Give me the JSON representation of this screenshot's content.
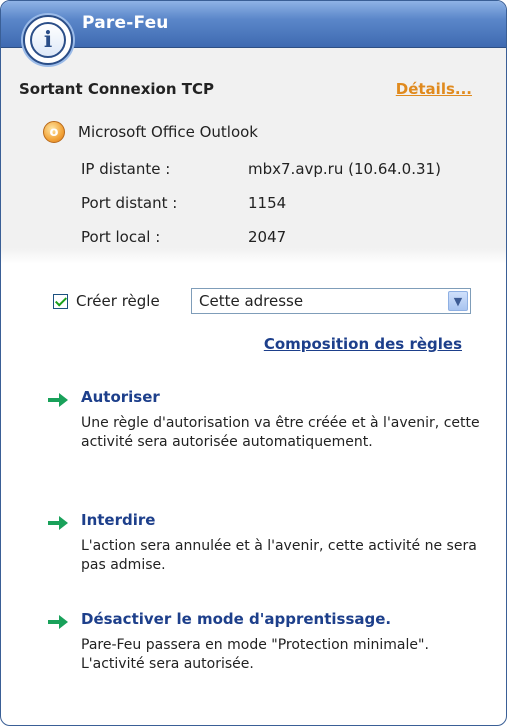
{
  "window": {
    "title": "Pare-Feu",
    "info_icon": "info-icon"
  },
  "alert": {
    "heading": "Sortant Connexion TCP",
    "details_link": "Détails...",
    "app": {
      "icon": "outlook-icon",
      "name": "Microsoft Office Outlook"
    },
    "rows": [
      {
        "label": "IP distante :",
        "value": "mbx7.avp.ru (10.64.0.31)"
      },
      {
        "label": "Port distant :",
        "value": "1154"
      },
      {
        "label": "Port local :",
        "value": "2047"
      }
    ]
  },
  "rule": {
    "checkbox_checked": true,
    "checkbox_label": "Créer règle",
    "selected_option": "Cette adresse",
    "composition_link": "Composition des règles"
  },
  "actions": [
    {
      "icon": "green-arrow-icon",
      "title": "Autoriser",
      "description": "Une règle d'autorisation va être créée et à l'avenir, cette activité sera autorisée automatiquement."
    },
    {
      "icon": "green-arrow-icon",
      "title": "Interdire",
      "description": "L'action sera annulée et à l'avenir, cette activité ne sera pas admise."
    },
    {
      "icon": "green-arrow-icon",
      "title": "Désactiver le mode d'apprentissage.",
      "description": "Pare-Feu passera en mode \"Protection minimale\". L'activité sera autorisée."
    }
  ],
  "colors": {
    "title_bar": "#4d77bd",
    "link_blue": "#1d3f8b",
    "details_orange": "#e08a1e",
    "arrow_green": "#19a15a"
  }
}
